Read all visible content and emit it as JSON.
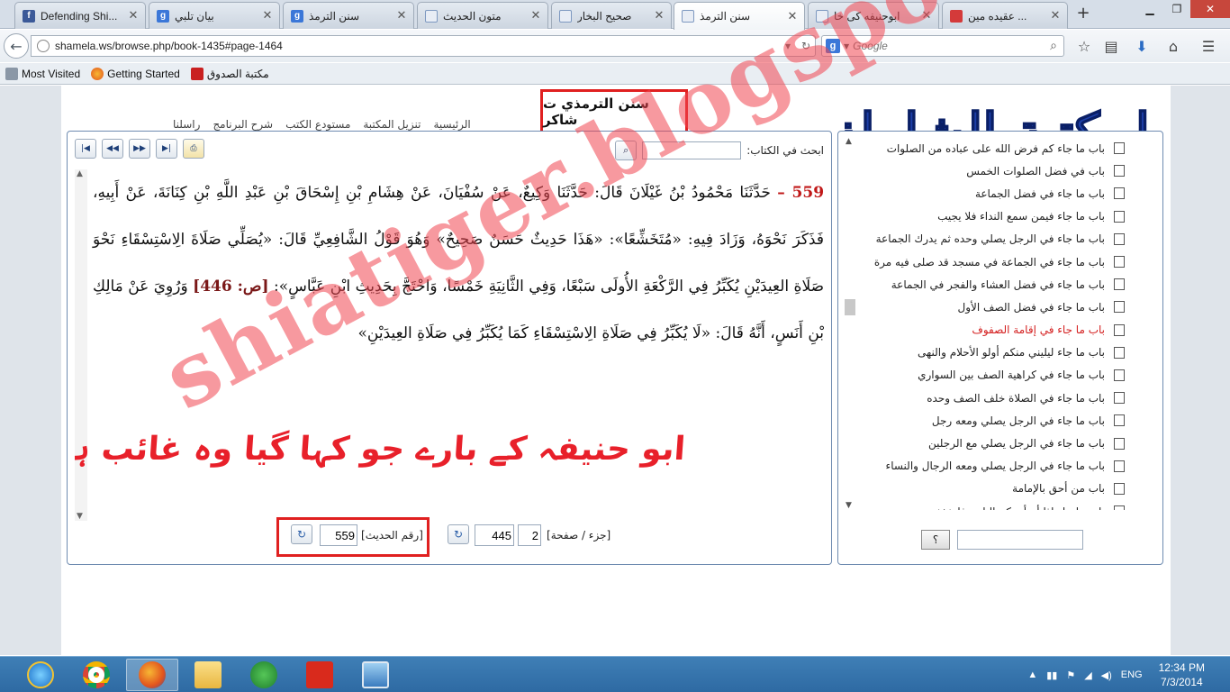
{
  "browser": {
    "tabs": [
      {
        "title": "Defending Shi...",
        "favicon": "facebook-icon",
        "color": "#3b5998"
      },
      {
        "title": "بيان تلبي",
        "favicon": "google-icon",
        "color": "#3b77d8"
      },
      {
        "title": "سنن الترمذ",
        "favicon": "google-icon",
        "color": "#3b77d8"
      },
      {
        "title": "متون الحديث",
        "favicon": "book-icon",
        "color": "#6a8fc0"
      },
      {
        "title": "صحيح البخار",
        "favicon": "book-icon",
        "color": "#6a8fc0"
      },
      {
        "title": "سنن الترمذ",
        "favicon": "book-icon",
        "color": "#6a8fc0"
      },
      {
        "title": "ابوحنیفه کی خا",
        "favicon": "book-icon",
        "color": "#6a8fc0"
      },
      {
        "title": "عقیده مین ...",
        "favicon": "grid-icon",
        "color": "#d43a3a"
      }
    ],
    "active_tab": 5,
    "url": "shamela.ws/browse.php/book-1435#page-1464",
    "search_placeholder": "Google",
    "bookmarks": [
      {
        "label": "Most Visited",
        "icon": "most-visited-icon"
      },
      {
        "label": "Getting Started",
        "icon": "firefox-icon"
      },
      {
        "label": "مكتبة الصدوق",
        "icon": "sadooq-icon"
      }
    ]
  },
  "site": {
    "logo_text": "المكتبة الشاملة",
    "menu": [
      "الرئيسية",
      "تنزيل المكتبة",
      "مستودع الكتب",
      "شرح البرنامج",
      "راسلنا"
    ]
  },
  "book": {
    "title": "سنن الترمذي ت شاكر",
    "search_label": "ابحث في الكتاب:",
    "hadith_number": "559 –",
    "hadith_part1": "حَدَّثَنَا مَحْمُودُ بْنُ غَيْلَانَ قَالَ: حَدَّثَنَا وَكِيعٌ، عَنْ سُفْيَانَ، عَنْ هِشَامِ بْنِ إِسْحَاقَ بْنِ عَبْدِ اللَّهِ بْنِ كِنَانَةَ، عَنْ أَبِيهِ، فَذَكَرَ نَحْوَهُ، وَزَادَ فِيهِ: «مُتَخَشِّعًا»: «هَذَا حَدِيثٌ حَسَنٌ صَحِيحٌ» وَهُوَ قَوْلُ الشَّافِعِيِّ قَالَ: «يُصَلِّي صَلَاةَ الِاسْتِسْقَاءِ نَحْوَ صَلَاةِ العِيدَيْنِ يُكَبِّرُ فِي الرَّكْعَةِ الأُولَى سَبْعًا، وَفِي الثَّانِيَةِ خَمْسًا، وَاحْتَجَّ بِحَدِيثِ ابْنِ عَبَّاسٍ»:",
    "page_ref": "[ص: 446]",
    "hadith_part2": "وَرُوِيَ عَنْ مَالِكِ بْنِ أَنَسٍ، أَنَّهُ قَالَ: «لَا يُكَبِّرُ فِي صَلَاةِ الِاسْتِسْقَاءِ كَمَا يُكَبِّرُ فِي صَلَاةِ العِيدَيْنِ»",
    "annotation": "ابو حنیفہ کے بارے جو کہا گیا وہ غائب ہے",
    "part_page_label": "[جزء / صفحة]",
    "part_value": "2",
    "page_value": "445",
    "hadith_label": "[رقم الحديث]",
    "hadith_value": "559"
  },
  "toc": {
    "items": [
      "باب ما جاء كم فرض الله على عباده من الصلوات",
      "باب في فضل الصلوات الخمس",
      "باب ما جاء في فضل الجماعة",
      "باب ما جاء فيمن سمع النداء فلا يجيب",
      "باب ما جاء في الرجل يصلي وحده ثم يدرك الجماعة",
      "باب ما جاء في الجماعة في مسجد قد صلى فيه مرة",
      "باب ما جاء في فضل العشاء والفجر في الجماعة",
      "باب ما جاء في فضل الصف الأول",
      "باب ما جاء في إقامة الصفوف",
      "باب ما جاء ليليني منكم أولو الأحلام والنهى",
      "باب ما جاء في كراهية الصف بين السواري",
      "باب ما جاء في الصلاة خلف الصف وحده",
      "باب ما جاء في الرجل يصلي ومعه رجل",
      "باب ما جاء في الرجل يصلي مع الرجلين",
      "باب ما جاء في الرجل يصلي ومعه الرجال والنساء",
      "باب من أحق بالإمامة",
      "باب ما جاء إذا أم أحدكم الناس فليخفف"
    ],
    "selected_index": 8,
    "search_button": "؟"
  },
  "watermark": "shiatiger.blogspot.com",
  "taskbar": {
    "apps": [
      "internet-explorer-icon",
      "chrome-icon",
      "firefox-icon",
      "file-explorer-icon",
      "network-app-icon",
      "acrobat-icon",
      "image-viewer-icon"
    ],
    "active_app": 2,
    "lang": "ENG",
    "time": "12:34 PM",
    "date": "7/3/2014"
  },
  "colors": {
    "accent_red": "#e02020",
    "panel_border": "#6e8bb0",
    "taskbar": "#3574ad"
  }
}
